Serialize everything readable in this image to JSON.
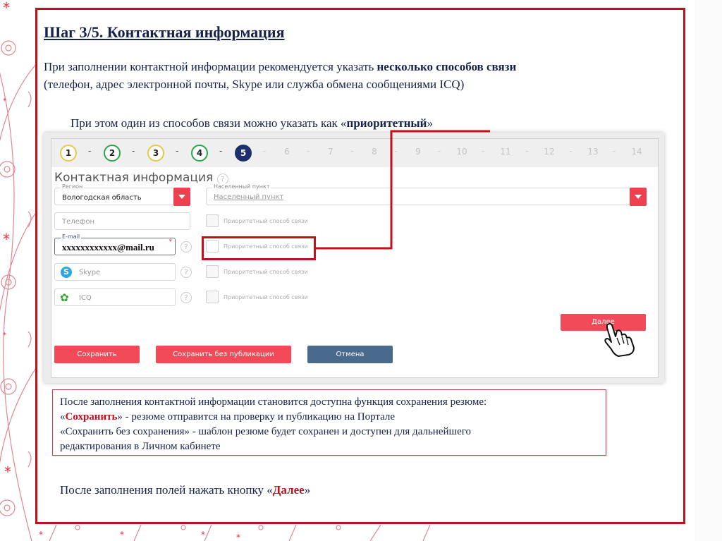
{
  "slide": {
    "title": "Шаг 3/5. Контактная информация",
    "intro_text": "При заполнении контактной информации рекомендуется указать ",
    "intro_bold": "несколько способов связи",
    "intro_line2": "(телефон, адрес электронной почты, Skype или служба обмена сообщениями ICQ)",
    "priority_prefix": "При этом один из способов связи можно указать как «",
    "priority_bold": "приоритетный",
    "priority_suffix": "»"
  },
  "form": {
    "steps": [
      {
        "label": "1",
        "state": "yellow"
      },
      {
        "label": "2",
        "state": "green"
      },
      {
        "label": "3",
        "state": "yellow"
      },
      {
        "label": "4",
        "state": "green"
      },
      {
        "label": "5",
        "state": "active"
      },
      {
        "label": "6",
        "state": "future"
      },
      {
        "label": "7",
        "state": "future"
      },
      {
        "label": "8",
        "state": "future"
      },
      {
        "label": "9",
        "state": "future"
      },
      {
        "label": "10",
        "state": "future"
      },
      {
        "label": "11",
        "state": "future"
      },
      {
        "label": "12",
        "state": "future"
      },
      {
        "label": "13",
        "state": "future"
      },
      {
        "label": "14",
        "state": "future"
      }
    ],
    "step_separator": "-",
    "title": "Контактная информация",
    "help_glyph": "?",
    "region": {
      "legend": "Регион",
      "value": "Вологодская область"
    },
    "locality": {
      "legend": "Населенный пункт",
      "placeholder": "Населенный пункт"
    },
    "phone": {
      "placeholder": "Телефон"
    },
    "email": {
      "legend": "E-mail",
      "value": "xxxxxxxxxxxx@mail.ru",
      "required_mark": "*"
    },
    "skype": {
      "placeholder": "Skype"
    },
    "icq": {
      "placeholder": "ICQ"
    },
    "priority_label": "Приоритетный способ связи",
    "buttons": {
      "next": "Далее",
      "save": "Сохранить",
      "save_no_publish": "Сохранить без публикации",
      "cancel": "Отмена"
    }
  },
  "info": {
    "line1": "После заполнения контактной информации становится доступна функция сохранения резюме:",
    "line2_quote_open": "«",
    "line2_bold": "Сохранить",
    "line2_rest": "» -  резюме отправится на проверку и публикацию на Портале",
    "line3": "«Сохранить без сохранения» - шаблон резюме будет сохранен и доступен для дальнейшего",
    "line4": "редактирования в Личном кабинете"
  },
  "final": {
    "prefix": "После заполнения полей нажать кнопку «",
    "bold": "Далее",
    "suffix": "»"
  },
  "colors": {
    "accent_red": "#c0101c",
    "text_navy": "#15224a",
    "button_red": "#f24a58",
    "button_blue": "#4a6a8c",
    "active_step": "#1d2f6e"
  }
}
